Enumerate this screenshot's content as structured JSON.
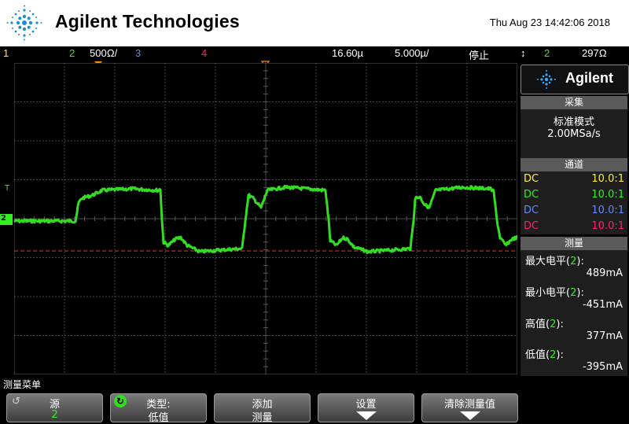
{
  "header": {
    "brand": "Agilent Technologies",
    "datetime": "Thu Aug 23 14:42:06 2018"
  },
  "status_bar": {
    "ch1": "1",
    "ch2": "2",
    "ch2_scale": "500Ω/",
    "ch3": "3",
    "ch4": "4",
    "time_delay": "16.60µ",
    "time_scale": "5.000µ/",
    "run_state": "停止",
    "trigger_source": "2",
    "trigger_level": "297Ω"
  },
  "scope": {
    "ch2_marker": "2",
    "trigger_marker": "T",
    "trace_color": "#33dd22"
  },
  "side_panel": {
    "brand": "Agilent",
    "acquire": {
      "title": "采集",
      "mode": "标准模式",
      "rate": "2.00MSa/s"
    },
    "channels": {
      "title": "通道",
      "rows": [
        {
          "coupling": "DC",
          "ratio": "10.0:1",
          "color": "#ffee33"
        },
        {
          "coupling": "DC",
          "ratio": "10.0:1",
          "color": "#33ee22"
        },
        {
          "coupling": "DC",
          "ratio": "10.0:1",
          "color": "#6688ff"
        },
        {
          "coupling": "DC",
          "ratio": "10.0:1",
          "color": "#ff2266"
        }
      ]
    },
    "measure": {
      "title": "测量",
      "items": [
        {
          "label": "最大电平",
          "ch": "2",
          "value": "489mA"
        },
        {
          "label": "最小电平",
          "ch": "2",
          "value": "-451mA"
        },
        {
          "label": "高值",
          "ch": "2",
          "value": "377mA"
        },
        {
          "label": "低值",
          "ch": "2",
          "value": "-395mA"
        }
      ]
    }
  },
  "softkeys": {
    "menu_title": "测量菜单",
    "source_label": "源",
    "source_value": "2",
    "type_label": "类型:",
    "type_value": "低值",
    "add_line1": "添加",
    "add_line2": "测量",
    "settings_label": "设置",
    "clear_label": "清除测量值"
  }
}
